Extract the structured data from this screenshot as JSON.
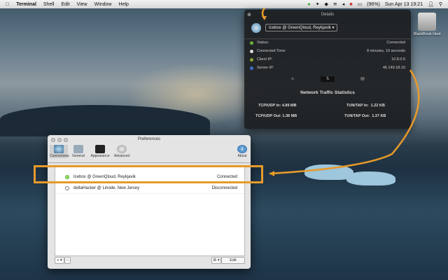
{
  "menubar": {
    "app": "Terminal",
    "items": [
      "Shell",
      "Edit",
      "View",
      "Window",
      "Help"
    ],
    "battery": "(96%)",
    "clock": "Sun Apr 13  19:21"
  },
  "desktop": {
    "drive_label": "BlackBook Host"
  },
  "details": {
    "title": "Details",
    "server": "Icebox @ GreenQloud, Reykjavik",
    "stats": [
      {
        "label": "Status:",
        "value": "Connected",
        "color": "#6cb33f"
      },
      {
        "label": "Connected Time:",
        "value": "8 minutes, 19 seconds",
        "color": "#dddddd"
      },
      {
        "label": "Client IP:",
        "value": "10.8.0.6",
        "color": "#8aa82e"
      },
      {
        "label": "Server IP:",
        "value": "46.149.18.10",
        "color": "#3a6fc8"
      }
    ],
    "traffic_title": "Network Traffic Statistics",
    "traffic": {
      "tcp_in_label": "TCP/UDP In:",
      "tcp_in": "4.89 MB",
      "tcp_out_label": "TCP/UDP Out:",
      "tcp_out": "1.38 MB",
      "tun_in_label": "TUN/TAP In:",
      "tun_in": "1.22 KB",
      "tun_out_label": "TUN/TAP Out:",
      "tun_out": "1.37 KB"
    }
  },
  "preferences": {
    "title": "Preferences",
    "toolbar": [
      "Connections",
      "General",
      "Appearance",
      "Advanced",
      "About"
    ],
    "connections": [
      {
        "name": "Icebox @ GreenQloud, Reykjavik",
        "status": "Connected",
        "color": "#5cb33a"
      },
      {
        "name": "deltaHacker @ Linode, New Jersey",
        "status": "Disconnected",
        "color": "#777777"
      }
    ],
    "add": "+ ▾",
    "remove": "−",
    "gear": "⚙ ▾",
    "edit": "Edit"
  },
  "accent": "#e79a2a"
}
